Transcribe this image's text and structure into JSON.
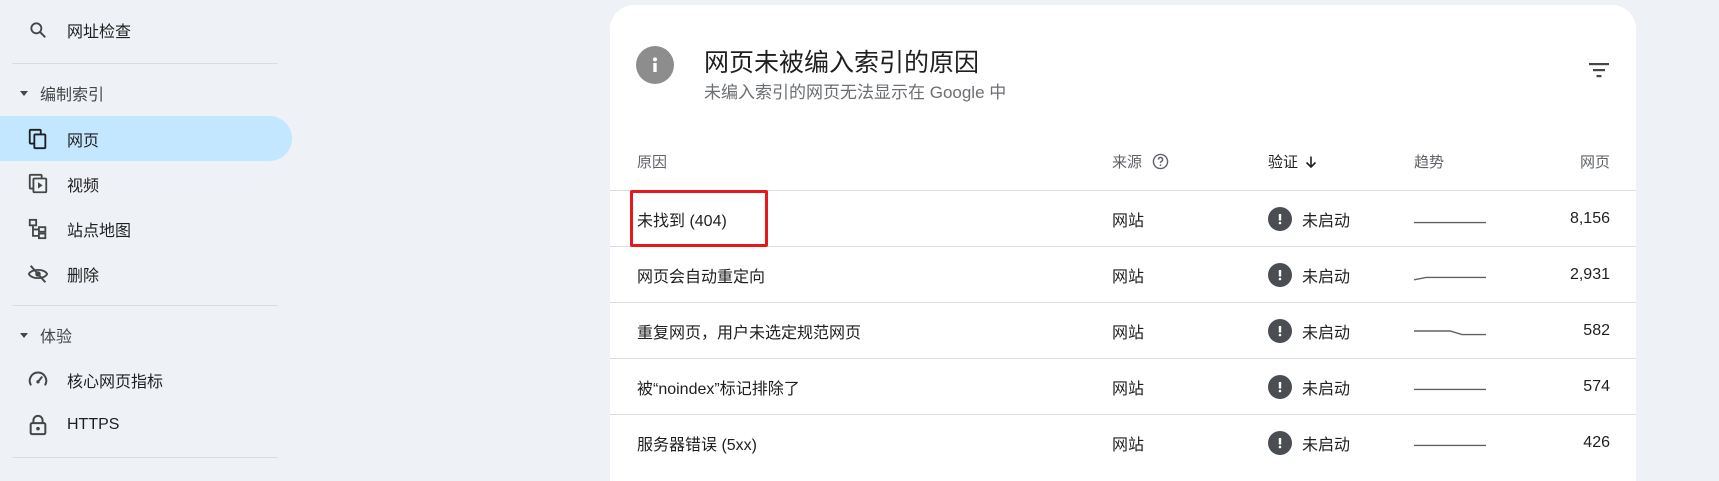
{
  "sidebar": {
    "url_inspection": "网址检查",
    "section_indexing": "编制索引",
    "pages": "网页",
    "videos": "视频",
    "sitemaps": "站点地图",
    "removals": "删除",
    "section_experience": "体验",
    "core_web_vitals": "核心网页指标",
    "https": "HTTPS",
    "active_item": "网页"
  },
  "card": {
    "title": "网页未被编入索引的原因",
    "subtitle": "未编入索引的网页无法显示在 Google 中",
    "columns": {
      "reason": "原因",
      "source": "来源",
      "validation": "验证",
      "trend": "趋势",
      "pages": "网页"
    },
    "rows": [
      {
        "reason": "未找到 (404)",
        "source": "网站",
        "validation": "未启动",
        "pages": "8,156",
        "trend": [
          0.2,
          0.2,
          0.2,
          0.2,
          0.2,
          0.2,
          0.2
        ]
      },
      {
        "reason": "网页会自动重定向",
        "source": "网站",
        "validation": "未启动",
        "pages": "2,931",
        "trend": [
          0.1,
          0.3,
          0.3,
          0.3,
          0.3,
          0.3,
          0.3
        ]
      },
      {
        "reason": "重复网页，用户未选定规范网页",
        "source": "网站",
        "validation": "未启动",
        "pages": "582",
        "trend": [
          0.5,
          0.5,
          0.5,
          0.5,
          0.2,
          0.2,
          0.2
        ]
      },
      {
        "reason": "被“noindex”标记排除了",
        "source": "网站",
        "validation": "未启动",
        "pages": "574",
        "trend": [
          0.3,
          0.3,
          0.3,
          0.3,
          0.3,
          0.3,
          0.3
        ]
      },
      {
        "reason": "服务器错误 (5xx)",
        "source": "网站",
        "validation": "未启动",
        "pages": "426",
        "trend": [
          0.3,
          0.3,
          0.3,
          0.3,
          0.3,
          0.3,
          0.3
        ]
      }
    ]
  },
  "colors": {
    "active_nav": "#c2e7ff",
    "highlight": "#e8171c",
    "status_icon": "#4a4d52"
  }
}
